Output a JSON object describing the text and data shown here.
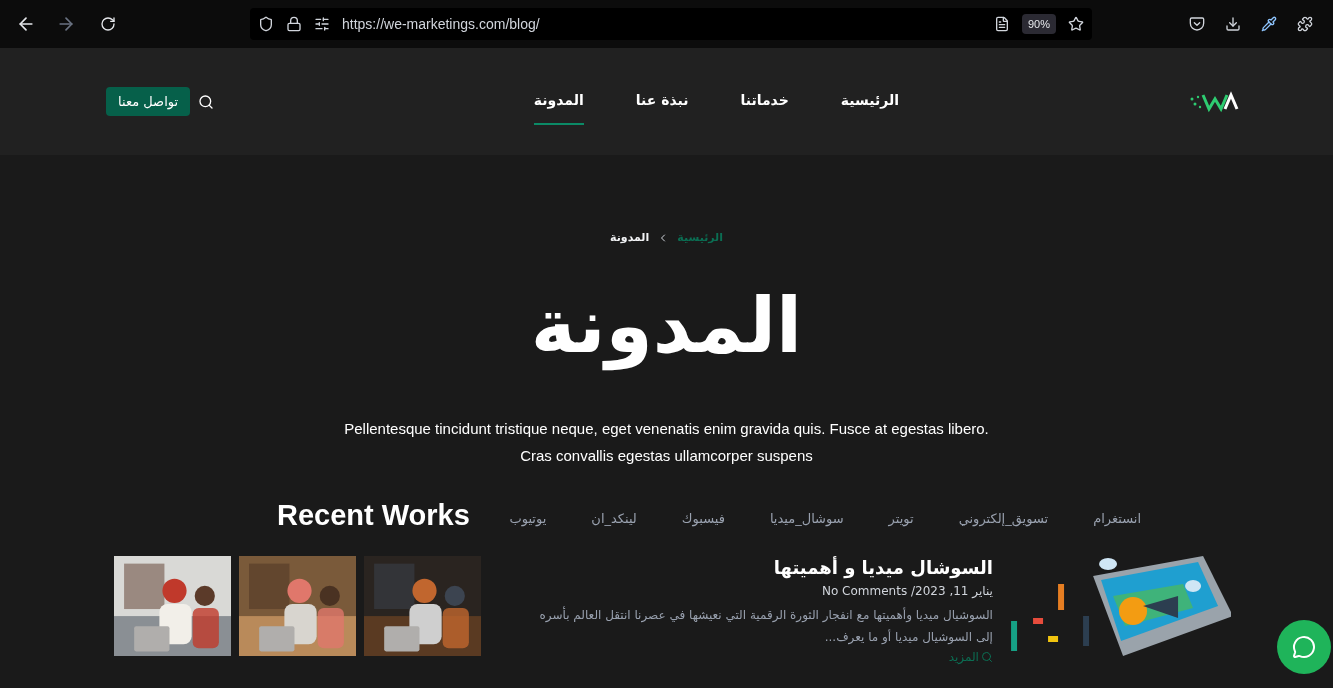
{
  "browser": {
    "url": "https://we-marketings.com/blog/",
    "zoom": "90%"
  },
  "nav": {
    "items": [
      {
        "label": "الرئيسية",
        "selected": false
      },
      {
        "label": "خدماتنا",
        "selected": false
      },
      {
        "label": "نبذة عنا",
        "selected": false
      },
      {
        "label": "المدونة",
        "selected": true
      }
    ],
    "cta": "تواصل معنا"
  },
  "hero": {
    "breadcrumb": [
      "الرئيسية",
      "المدونة"
    ],
    "title": "المدونة",
    "description": "Pellentesque tincidunt tristique neque, eget venenatis enim gravida quis. Fusce at egestas libero. Cras convallis egestas ullamcorper suspens"
  },
  "tags": [
    "انستغرام",
    "تسويق_إلكتروني",
    "تويتر",
    "سوشال_ميديا",
    "فيسبوك",
    "لينكد_ان",
    "يوتيوب"
  ],
  "post": {
    "title": "السوشال ميديا و أهميتها",
    "date": "يناير 11, 2023/ No Comments",
    "excerpt": "السوشيال ميديا وأهميتها مع انفجار الثورة الرقمية التي نعيشها في عصرنا انتقل العالم بأسره إلى السوشيال ميديا أو ما يعرف...",
    "more": "المزيد"
  },
  "recent_works": {
    "title": "Recent Works"
  }
}
